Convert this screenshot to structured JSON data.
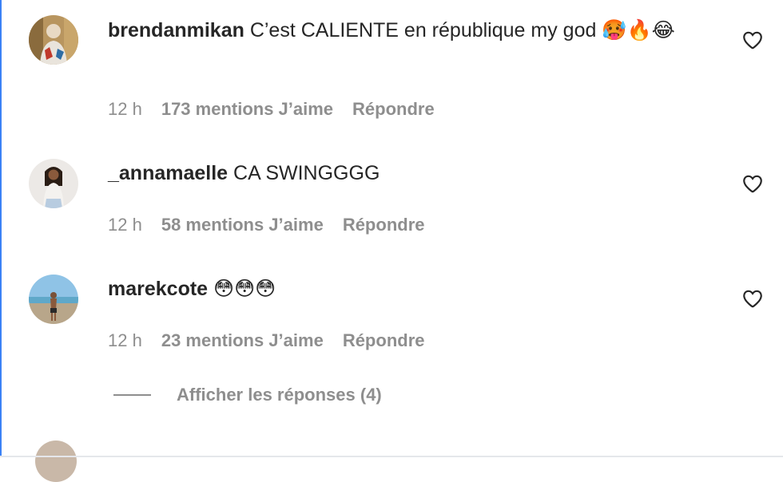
{
  "comments": [
    {
      "username": "brendanmikan",
      "text": "C’est CALIENTE en république my god 🥵🔥😂",
      "time": "12 h",
      "likes": "173 mentions J’aime",
      "reply": "Répondre"
    },
    {
      "username": "_annamaelle",
      "text": "CA SWINGGGG",
      "time": "12 h",
      "likes": "58 mentions J’aime",
      "reply": "Répondre"
    },
    {
      "username": "marekcote",
      "text": "😳😳😳",
      "time": "12 h",
      "likes": "23 mentions J’aime",
      "reply": "Répondre"
    }
  ],
  "view_replies": {
    "label": "Afficher les réponses (4)"
  },
  "icons": {
    "like": "heart-outline-icon"
  },
  "colors": {
    "text": "#262626",
    "muted": "#8e8e8e"
  }
}
